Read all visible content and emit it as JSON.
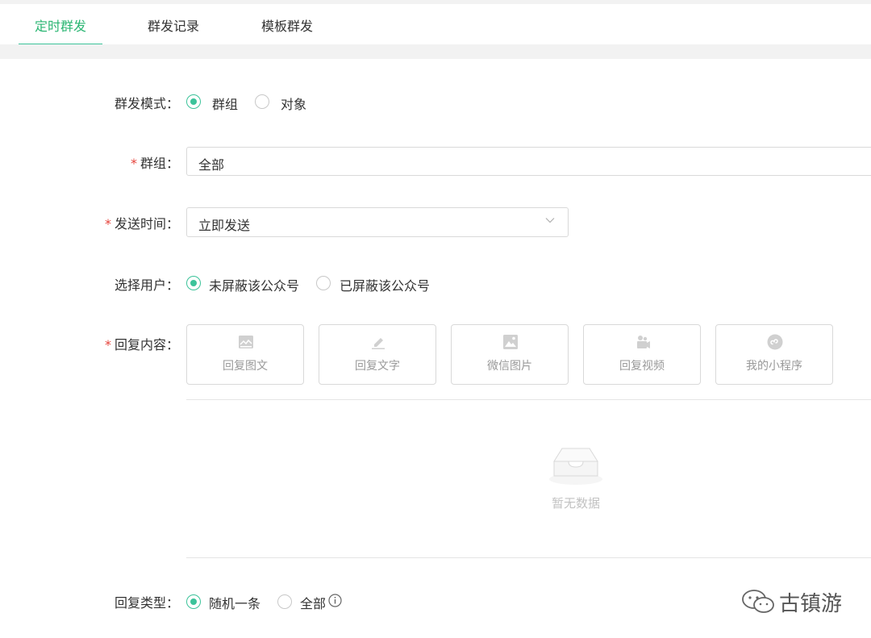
{
  "tabs": [
    {
      "label": "定时群发",
      "active": true
    },
    {
      "label": "群发记录",
      "active": false
    },
    {
      "label": "模板群发",
      "active": false
    }
  ],
  "form": {
    "mode": {
      "label": "群发模式：",
      "options": [
        {
          "label": "群组",
          "checked": true
        },
        {
          "label": "对象",
          "checked": false
        }
      ]
    },
    "group": {
      "required_mark": "*",
      "label": "群组：",
      "value": "全部"
    },
    "send_time": {
      "required_mark": "*",
      "label": "发送时间：",
      "value": "立即发送"
    },
    "users": {
      "label": "选择用户：",
      "options": [
        {
          "label": "未屏蔽该公众号",
          "checked": true
        },
        {
          "label": "已屏蔽该公众号",
          "checked": false
        }
      ]
    },
    "reply_content": {
      "required_mark": "*",
      "label": "回复内容：",
      "buttons": [
        {
          "label": "回复图文",
          "icon": "image-text-icon"
        },
        {
          "label": "回复文字",
          "icon": "pencil-icon"
        },
        {
          "label": "微信图片",
          "icon": "picture-icon"
        },
        {
          "label": "回复视频",
          "icon": "video-icon"
        },
        {
          "label": "我的小程序",
          "icon": "mini-program-icon"
        }
      ],
      "empty_text": "暂无数据"
    },
    "reply_type": {
      "label": "回复类型：",
      "options": [
        {
          "label": "随机一条",
          "checked": true
        },
        {
          "label": "全部",
          "checked": false
        }
      ]
    }
  },
  "watermark": {
    "text": "古镇游"
  },
  "colors": {
    "accent": "#3cc39a",
    "required": "#e6423a"
  }
}
